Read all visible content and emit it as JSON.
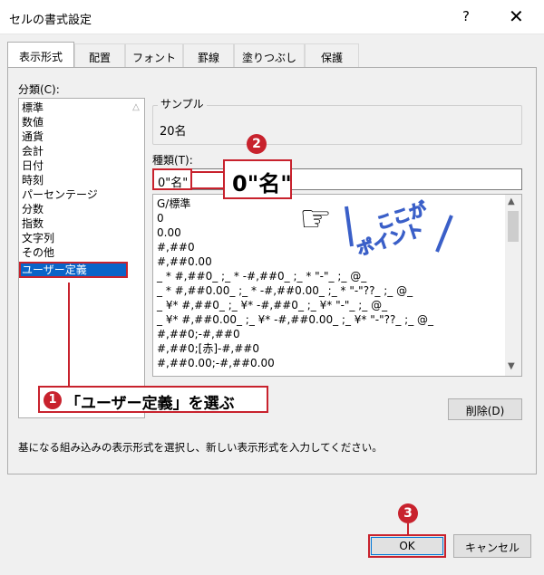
{
  "window": {
    "title": "セルの書式設定",
    "help": "?",
    "close": "✕"
  },
  "tabs": [
    "表示形式",
    "配置",
    "フォント",
    "罫線",
    "塗りつぶし",
    "保護"
  ],
  "category": {
    "label": "分類(C):",
    "items": [
      "標準",
      "数値",
      "通貨",
      "会計",
      "日付",
      "時刻",
      "パーセンテージ",
      "分数",
      "指数",
      "文字列",
      "その他",
      "ユーザー定義"
    ],
    "selected": "ユーザー定義"
  },
  "sample": {
    "label": "サンプル",
    "value": "20名"
  },
  "type": {
    "label": "種類(T):",
    "input_value": "0\"名\"",
    "formats": [
      "G/標準",
      "0",
      "0.00",
      "#,##0",
      "#,##0.00",
      "_ * #,##0_ ;_ * -#,##0_ ;_ * \"-\"_ ;_ @_",
      "_ * #,##0.00_ ;_ * -#,##0.00_ ;_ * \"-\"??_ ;_ @_",
      "_ ¥* #,##0_ ;_ ¥* -#,##0_ ;_ ¥* \"-\"_ ;_ @_",
      "_ ¥* #,##0.00_ ;_ ¥* -#,##0.00_ ;_ ¥* \"-\"??_ ;_ @_",
      "#,##0;-#,##0",
      "#,##0;[赤]-#,##0",
      "#,##0.00;-#,##0.00"
    ]
  },
  "delete_button": "削除(D)",
  "description": "基になる組み込みの表示形式を選択し、新しい表示形式を入力してください。",
  "buttons": {
    "ok": "OK",
    "cancel": "キャンセル"
  },
  "annotations": {
    "step1_num": "1",
    "step1_text": "「ユーザー定義」を選ぶ",
    "step2_num": "2",
    "step2_callout": "0\"名\"",
    "step3_num": "3",
    "point_text_1": "ここが",
    "point_text_2": "ポイント"
  },
  "colors": {
    "accent_red": "#c8222d",
    "selection_blue": "#0a64c8",
    "point_blue": "#3a5fc8"
  }
}
